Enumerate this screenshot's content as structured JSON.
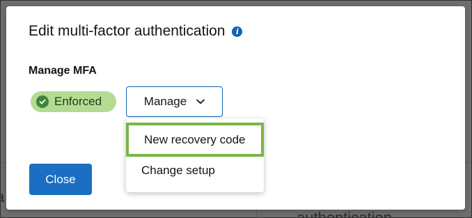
{
  "background": {
    "partial_text_left": "a",
    "partial_text_bottom": "authentication"
  },
  "modal": {
    "title": "Edit multi-factor authentication",
    "section_label": "Manage MFA",
    "status_badge": {
      "label": "Enforced",
      "color": "#b4db93",
      "icon": "check-circle-icon"
    },
    "manage_toggle": {
      "label": "Manage",
      "icon": "chevron-down-icon"
    },
    "menu": {
      "items": [
        {
          "label": "New recovery code",
          "highlighted": true,
          "highlight_color": "#7ab648"
        },
        {
          "label": "Change setup"
        }
      ]
    },
    "close_button": {
      "label": "Close",
      "color": "#1b6ec2"
    }
  }
}
